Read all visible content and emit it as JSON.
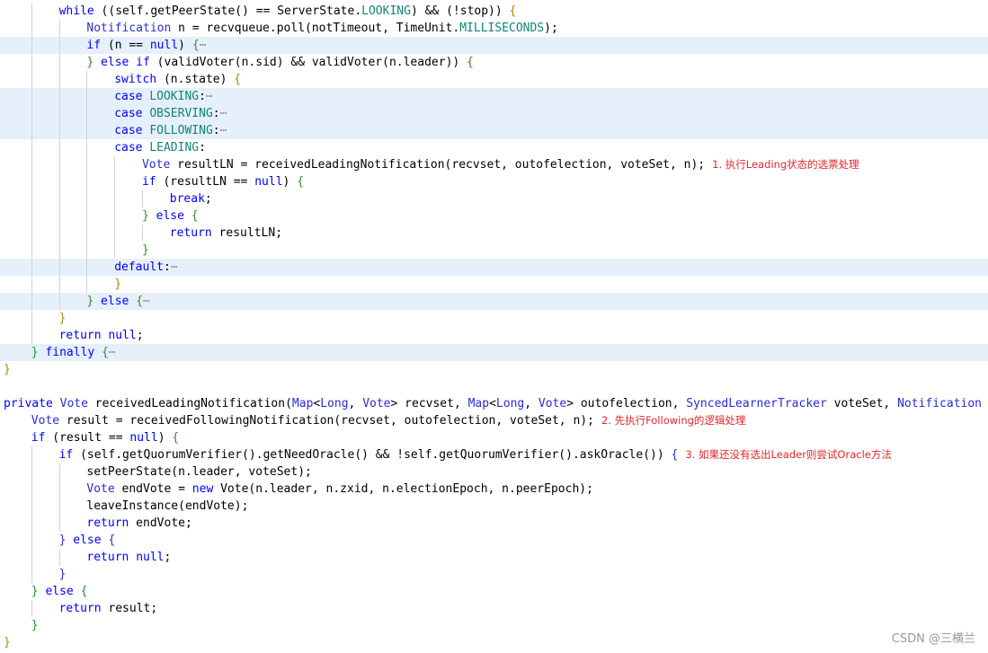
{
  "watermark": "CSDN @三横兰",
  "lines": [
    {
      "indent": 2,
      "tokens": [
        [
          "k",
          "while"
        ],
        [
          "p",
          " ((self.getPeerState() == ServerState."
        ],
        [
          "c",
          "LOOKING"
        ],
        [
          "p",
          ") && (!stop)) "
        ],
        [
          "b",
          "{"
        ]
      ]
    },
    {
      "indent": 3,
      "tokens": [
        [
          "t",
          "Notification"
        ],
        [
          "p",
          " n = recvqueue.poll(notTimeout, TimeUnit."
        ],
        [
          "c",
          "MILLISECONDS"
        ],
        [
          "p",
          ");"
        ]
      ]
    },
    {
      "indent": 3,
      "hl": true,
      "tokens": [
        [
          "k",
          "if"
        ],
        [
          "p",
          " (n == "
        ],
        [
          "k",
          "null"
        ],
        [
          "p",
          ") "
        ],
        [
          "b2",
          "{"
        ],
        [
          "e",
          "⋯"
        ]
      ]
    },
    {
      "indent": 3,
      "tokens": [
        [
          "b2",
          "}"
        ],
        [
          "p",
          " "
        ],
        [
          "k",
          "else if"
        ],
        [
          "p",
          " (validVoter(n.sid) && validVoter(n.leader)) "
        ],
        [
          "b2",
          "{"
        ]
      ]
    },
    {
      "indent": 4,
      "tokens": [
        [
          "k",
          "switch"
        ],
        [
          "p",
          " (n.state) "
        ],
        [
          "b",
          "{"
        ]
      ]
    },
    {
      "indent": 4,
      "hl": true,
      "tokens": [
        [
          "k",
          "case"
        ],
        [
          "p",
          " "
        ],
        [
          "c",
          "LOOKING"
        ],
        [
          "p",
          ":"
        ],
        [
          "e",
          "⋯"
        ]
      ]
    },
    {
      "indent": 4,
      "hl": true,
      "tokens": [
        [
          "k",
          "case"
        ],
        [
          "p",
          " "
        ],
        [
          "c",
          "OBSERVING"
        ],
        [
          "p",
          ":"
        ],
        [
          "e",
          "⋯"
        ]
      ]
    },
    {
      "indent": 4,
      "hl": true,
      "tokens": [
        [
          "k",
          "case"
        ],
        [
          "p",
          " "
        ],
        [
          "c",
          "FOLLOWING"
        ],
        [
          "p",
          ":"
        ],
        [
          "e",
          "⋯"
        ]
      ]
    },
    {
      "indent": 4,
      "tokens": [
        [
          "k",
          "case"
        ],
        [
          "p",
          " "
        ],
        [
          "c",
          "LEADING"
        ],
        [
          "p",
          ":"
        ]
      ]
    },
    {
      "indent": 5,
      "tokens": [
        [
          "t",
          "Vote"
        ],
        [
          "p",
          " resultLN = receivedLeadingNotification(recvset, outofelection, voteSet, n);"
        ]
      ],
      "note": "1. 执行Leading状态的选票处理"
    },
    {
      "indent": 5,
      "tokens": [
        [
          "k",
          "if"
        ],
        [
          "p",
          " (resultLN == "
        ],
        [
          "k",
          "null"
        ],
        [
          "p",
          ") "
        ],
        [
          "b2",
          "{"
        ]
      ]
    },
    {
      "indent": 6,
      "tokens": [
        [
          "k",
          "break"
        ],
        [
          "p",
          ";"
        ]
      ]
    },
    {
      "indent": 5,
      "tokens": [
        [
          "b2",
          "}"
        ],
        [
          "p",
          " "
        ],
        [
          "k",
          "else"
        ],
        [
          "p",
          " "
        ],
        [
          "b2",
          "{"
        ]
      ]
    },
    {
      "indent": 6,
      "tokens": [
        [
          "k",
          "return"
        ],
        [
          "p",
          " resultLN;"
        ]
      ]
    },
    {
      "indent": 5,
      "tokens": [
        [
          "b2",
          "}"
        ]
      ]
    },
    {
      "indent": 4,
      "hl": true,
      "tokens": [
        [
          "k",
          "default"
        ],
        [
          "p",
          ":"
        ],
        [
          "e",
          "⋯"
        ]
      ]
    },
    {
      "indent": 4,
      "tokens": [
        [
          "b",
          "}"
        ]
      ]
    },
    {
      "indent": 3,
      "hl": true,
      "tokens": [
        [
          "b2",
          "}"
        ],
        [
          "p",
          " "
        ],
        [
          "k",
          "else"
        ],
        [
          "p",
          " "
        ],
        [
          "b2",
          "{"
        ],
        [
          "e",
          "⋯"
        ]
      ]
    },
    {
      "indent": 2,
      "tokens": [
        [
          "b",
          "}"
        ]
      ]
    },
    {
      "indent": 2,
      "tokens": [
        [
          "k",
          "return"
        ],
        [
          "p",
          " "
        ],
        [
          "k",
          "null"
        ],
        [
          "p",
          ";"
        ]
      ]
    },
    {
      "indent": 1,
      "hl": true,
      "tokens": [
        [
          "b2",
          "}"
        ],
        [
          "p",
          " "
        ],
        [
          "k",
          "finally"
        ],
        [
          "p",
          " "
        ],
        [
          "b2",
          "{"
        ],
        [
          "e",
          "⋯"
        ]
      ]
    },
    {
      "indent": 0,
      "tokens": [
        [
          "b",
          "}"
        ]
      ]
    },
    {
      "indent": 0,
      "tokens": []
    },
    {
      "indent": 0,
      "tokens": [
        [
          "k",
          "private"
        ],
        [
          "p",
          " "
        ],
        [
          "t",
          "Vote"
        ],
        [
          "p",
          " receivedLeadingNotification("
        ],
        [
          "t",
          "Map"
        ],
        [
          "p",
          "<"
        ],
        [
          "t",
          "Long"
        ],
        [
          "p",
          ", "
        ],
        [
          "t",
          "Vote"
        ],
        [
          "p",
          "> recvset, "
        ],
        [
          "t",
          "Map"
        ],
        [
          "p",
          "<"
        ],
        [
          "t",
          "Long"
        ],
        [
          "p",
          ", "
        ],
        [
          "t",
          "Vote"
        ],
        [
          "p",
          "> outofelection, "
        ],
        [
          "t",
          "SyncedLearnerTracker"
        ],
        [
          "p",
          " voteSet, "
        ],
        [
          "t",
          "Notification"
        ],
        [
          "p",
          " n)"
        ]
      ]
    },
    {
      "indent": 1,
      "tokens": [
        [
          "t",
          "Vote"
        ],
        [
          "p",
          " result = receivedFollowingNotification(recvset, outofelection, voteSet, n);"
        ]
      ],
      "note": "2. 先执行Following的逻辑处理"
    },
    {
      "indent": 1,
      "tokens": [
        [
          "k",
          "if"
        ],
        [
          "p",
          " (result == "
        ],
        [
          "k",
          "null"
        ],
        [
          "p",
          ") "
        ],
        [
          "b2",
          "{"
        ]
      ]
    },
    {
      "indent": 2,
      "tokens": [
        [
          "k",
          "if"
        ],
        [
          "p",
          " (self.getQuorumVerifier().getNeedOracle() && !self.getQuorumVerifier().askOracle()) "
        ],
        [
          "t",
          "{"
        ]
      ],
      "note": "3. 如果还没有选出Leader则尝试Oracle方法"
    },
    {
      "indent": 3,
      "tokens": [
        [
          "p",
          "setPeerState(n.leader, voteSet);"
        ]
      ]
    },
    {
      "indent": 3,
      "tokens": [
        [
          "t",
          "Vote"
        ],
        [
          "p",
          " endVote = "
        ],
        [
          "k",
          "new"
        ],
        [
          "p",
          " Vote(n.leader, n.zxid, n.electionEpoch, n.peerEpoch);"
        ]
      ]
    },
    {
      "indent": 3,
      "tokens": [
        [
          "p",
          "leaveInstance(endVote);"
        ]
      ]
    },
    {
      "indent": 3,
      "tokens": [
        [
          "k",
          "return"
        ],
        [
          "p",
          " endVote;"
        ]
      ]
    },
    {
      "indent": 2,
      "tokens": [
        [
          "t",
          "}"
        ],
        [
          "p",
          " "
        ],
        [
          "k",
          "else"
        ],
        [
          "p",
          " "
        ],
        [
          "t",
          "{"
        ]
      ]
    },
    {
      "indent": 3,
      "tokens": [
        [
          "k",
          "return"
        ],
        [
          "p",
          " "
        ],
        [
          "k",
          "null"
        ],
        [
          "p",
          ";"
        ]
      ]
    },
    {
      "indent": 2,
      "tokens": [
        [
          "t",
          "}"
        ]
      ]
    },
    {
      "indent": 1,
      "tokens": [
        [
          "b2",
          "}"
        ],
        [
          "p",
          " "
        ],
        [
          "k",
          "else"
        ],
        [
          "p",
          " "
        ],
        [
          "b2",
          "{"
        ]
      ]
    },
    {
      "indent": 2,
      "tokens": [
        [
          "k",
          "return"
        ],
        [
          "p",
          " result;"
        ]
      ]
    },
    {
      "indent": 1,
      "tokens": [
        [
          "b2",
          "}"
        ]
      ]
    },
    {
      "indent": 0,
      "tokens": [
        [
          "b",
          "}"
        ]
      ]
    }
  ]
}
